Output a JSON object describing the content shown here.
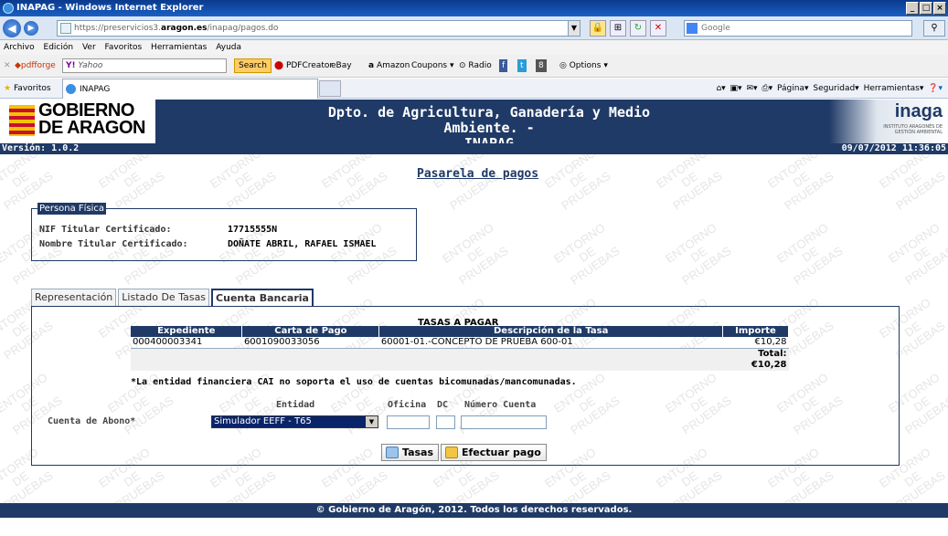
{
  "browser": {
    "title": "INAPAG - Windows Internet Explorer",
    "url_prefix": "https://preservicios3.",
    "url_domain": "aragon.es",
    "url_path": "/inapag/pagos.do",
    "search_placeholder": "Google",
    "menu": [
      "Archivo",
      "Edición",
      "Ver",
      "Favoritos",
      "Herramientas",
      "Ayuda"
    ],
    "toolbar": {
      "pdfforge": "pdfforge",
      "yahoo": "Yahoo",
      "search": "Search",
      "pdfcreator": "PDFCreator",
      "ebay": "eBay",
      "amazon": "Amazon",
      "coupons": "Coupons",
      "radio": "Radio",
      "options": "Options"
    },
    "favorites": "Favoritos",
    "tab_label": "INAPAG",
    "commands": [
      "Página",
      "Seguridad",
      "Herramientas"
    ]
  },
  "header": {
    "gob_line1": "GOBIERNO",
    "gob_line2": "DE ARAGON",
    "title_line1": "Dpto. de Agricultura, Ganadería y Medio Ambiente. -",
    "title_line2": "INAPAG",
    "inaga": "inaga",
    "inaga_sub": "INSTITUTO ARAGONÉS DE GESTIÓN AMBIENTAL",
    "version": "Versión: 1.0.2",
    "datetime": "09/07/2012 11:36:05"
  },
  "watermark": {
    "line1": "ENTORNO",
    "line2": "DE",
    "line3": "PRUEBAS"
  },
  "page_title": "Pasarela de pagos",
  "persona": {
    "legend": "Persona Física",
    "nif_label": "NIF Titular Certificado:",
    "nif_value": "17715555N",
    "nombre_label": "Nombre Titular Certificado:",
    "nombre_value": "DOÑATE ABRIL, RAFAEL ISMAEL"
  },
  "tabs": [
    "Representación",
    "Listado De Tasas",
    "Cuenta Bancaria"
  ],
  "tasas": {
    "heading": "TASAS A PAGAR",
    "columns": [
      "Expediente",
      "Carta de Pago",
      "Descripción de la Tasa",
      "Importe"
    ],
    "rows": [
      {
        "expediente": "000400003341",
        "carta": "6001090033056",
        "descripcion": "60001-01.-CONCEPTO DE PRUEBA 600-01",
        "importe": "€10,28"
      }
    ],
    "total": "Total: €10,28"
  },
  "note": "*La entidad financiera CAI no soporta el uso de cuentas bicomunadas/mancomunadas.",
  "cuenta": {
    "label": "Cuenta de Abono*",
    "entidad_label": "Entidad",
    "oficina_label": "Oficina",
    "dc_label": "DC",
    "numero_label": "Número Cuenta",
    "entidad_value": "Simulador EEFF - T65"
  },
  "buttons": {
    "tasas": "Tasas",
    "pagar": "Efectuar pago"
  },
  "footer": "© Gobierno de Aragón, 2012. Todos los derechos reservados."
}
